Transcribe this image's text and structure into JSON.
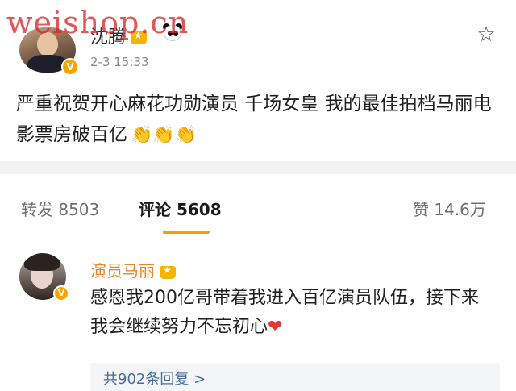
{
  "watermark": "weishop.cn",
  "post": {
    "author": "沈腾",
    "time": "2-3 15:33",
    "text": "严重祝贺开心麻花功勋演员 千场女皇 我的最佳拍档马丽电影票房破百亿",
    "emoji": "👏👏👏",
    "favorite_icon": "star-outline-icon"
  },
  "tabs": {
    "repost_label": "转发",
    "repost_count": "8503",
    "comment_label": "评论",
    "comment_count": "5608",
    "like_label": "赞",
    "like_count": "14.6万",
    "active": "comment",
    "accent_color": "#f39c12"
  },
  "comment": {
    "author": "演员马丽",
    "text": "感恩我200亿哥带着我进入百亿演员队伍，接下来我会继续努力不忘初心",
    "emoji": "❤",
    "replies_label": "共902条回复 >"
  },
  "colors": {
    "comment_author": "#e8862a",
    "reply_link": "#4a6d9a",
    "verified_badge": "#f6a400"
  }
}
